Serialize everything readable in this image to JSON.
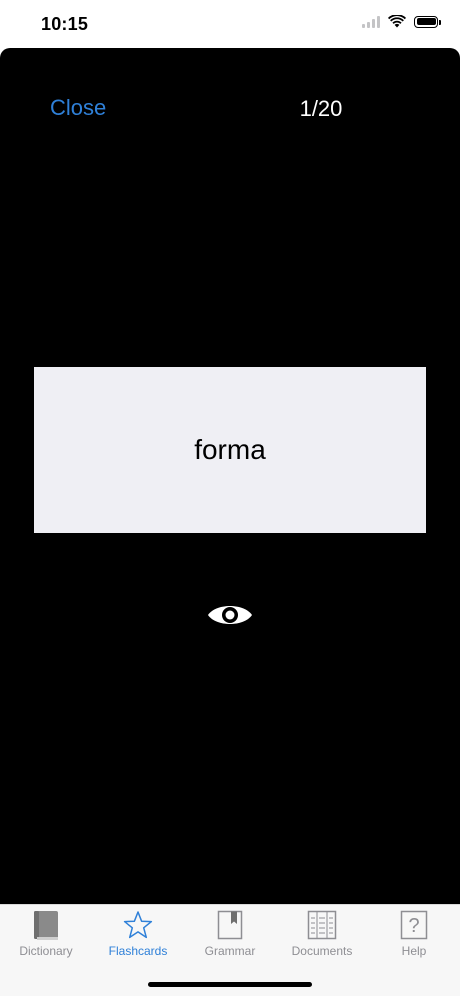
{
  "status_bar": {
    "time": "10:15"
  },
  "flashcard": {
    "close_label": "Close",
    "counter": "1/20",
    "word": "forma"
  },
  "tab_bar": {
    "tabs": [
      {
        "label": "Dictionary",
        "icon": "book-icon",
        "active": false
      },
      {
        "label": "Flashcards",
        "icon": "star-icon",
        "active": true
      },
      {
        "label": "Grammar",
        "icon": "bookmark-icon",
        "active": false
      },
      {
        "label": "Documents",
        "icon": "document-icon",
        "active": false
      },
      {
        "label": "Help",
        "icon": "question-icon",
        "active": false
      }
    ]
  },
  "colors": {
    "accent": "#2f80d8",
    "card_background": "#efeff4",
    "modal_background": "#000000",
    "inactive_tab": "#8e8e93"
  }
}
